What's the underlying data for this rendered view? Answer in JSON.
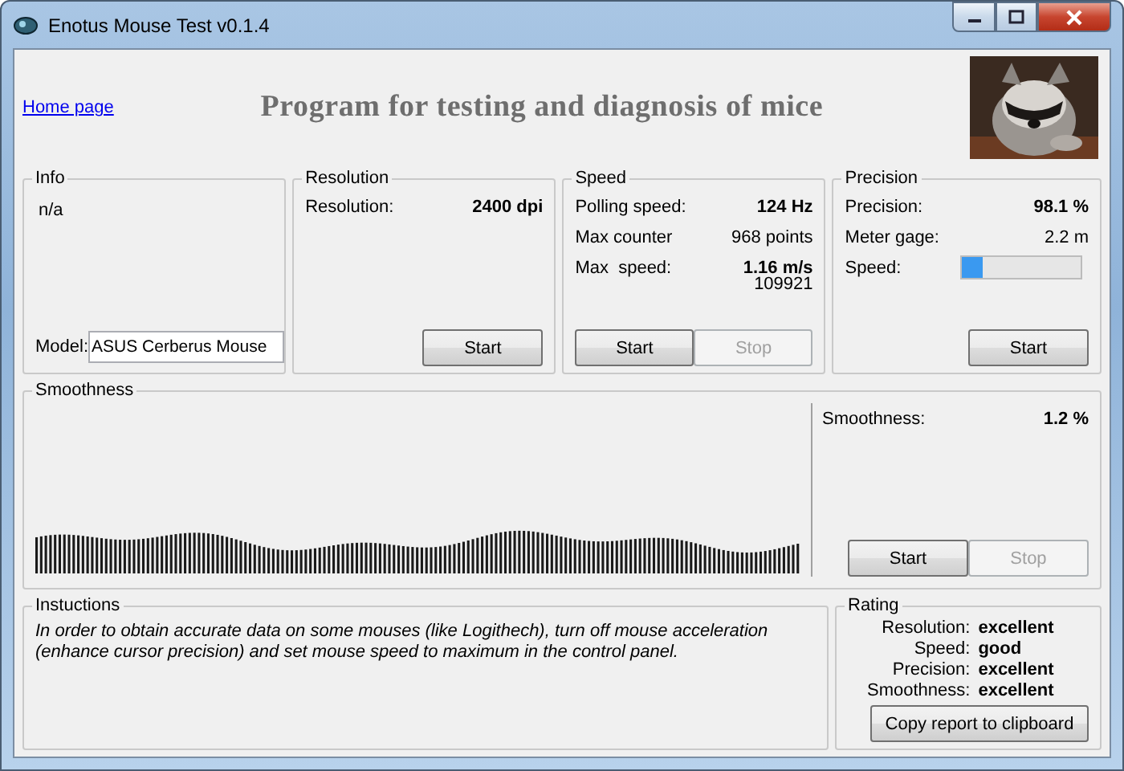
{
  "window": {
    "title": "Enotus Mouse Test v0.1.4"
  },
  "header": {
    "link": "Home page",
    "heading": "Program for testing and diagnosis of mice"
  },
  "info": {
    "title": "Info",
    "text": "n/a",
    "model_label": "Model:",
    "model_value": "ASUS Cerberus Mouse"
  },
  "resolution": {
    "title": "Resolution",
    "rows": [
      {
        "kind": "value",
        "label": "Resolution:",
        "value": "2400 dpi",
        "bold": true
      }
    ],
    "buttons": [
      {
        "label": "Start",
        "disabled": false
      }
    ]
  },
  "speed": {
    "title": "Speed",
    "rows": [
      {
        "kind": "value",
        "label": "Polling speed:",
        "value": "124 Hz",
        "bold": true
      },
      {
        "kind": "value",
        "label": "Max counter",
        "value": "968 points",
        "bold": false
      },
      {
        "kind": "value",
        "label": "Max  speed:",
        "value": "1.16 m/s",
        "bold": true,
        "note": "109921"
      }
    ],
    "buttons": [
      {
        "label": "Start",
        "disabled": false
      },
      {
        "label": "Stop",
        "disabled": true
      }
    ]
  },
  "precision": {
    "title": "Precision",
    "rows": [
      {
        "kind": "value",
        "label": "Precision:",
        "value": "98.1 %",
        "bold": true
      },
      {
        "kind": "value",
        "label": "Meter gage:",
        "value": "2.2 m",
        "bold": false
      },
      {
        "kind": "meter",
        "label": "Speed:",
        "level": 0.18
      }
    ],
    "buttons": [
      {
        "label": "Start",
        "disabled": false
      }
    ]
  },
  "smoothness": {
    "title": "Smoothness",
    "label": "Smoothness:",
    "value": "1.2 %",
    "buttons": [
      {
        "label": "Start",
        "disabled": false
      },
      {
        "label": "Stop",
        "disabled": true
      }
    ]
  },
  "instructions": {
    "title": "Instuctions",
    "text": "In order to obtain accurate data on some mouses (like Logithech), turn off mouse acceleration (enhance cursor precision) and set mouse speed to maximum in the control panel."
  },
  "rating": {
    "title": "Rating",
    "rows": [
      {
        "label": "Resolution:",
        "value": "excellent"
      },
      {
        "label": "Speed:",
        "value": "good"
      },
      {
        "label": "Precision:",
        "value": "excellent"
      },
      {
        "label": "Smoothness:",
        "value": "excellent"
      }
    ],
    "button": "Copy report to clipboard"
  }
}
